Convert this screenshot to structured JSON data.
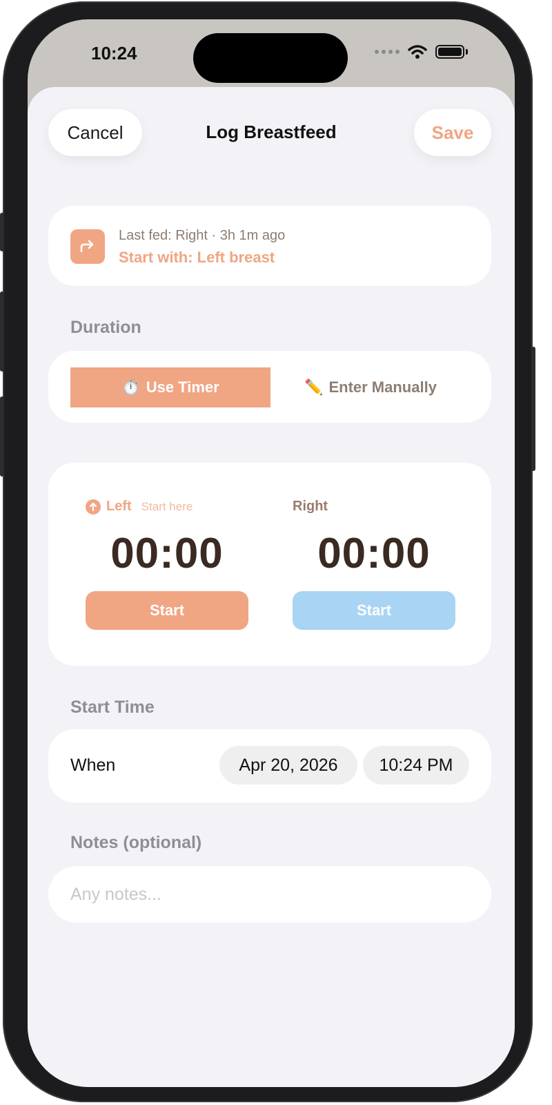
{
  "status_bar": {
    "time": "10:24"
  },
  "header": {
    "cancel_label": "Cancel",
    "title": "Log Breastfeed",
    "save_label": "Save"
  },
  "last_fed": {
    "summary": "Last fed: Right · 3h 1m ago",
    "recommendation": "Start with: Left breast",
    "icon": "arrow-turn-right-icon"
  },
  "duration": {
    "section_label": "Duration",
    "modes": [
      {
        "emoji": "⏱️",
        "label": "Use Timer",
        "selected": true
      },
      {
        "emoji": "✏️",
        "label": "Enter Manually",
        "selected": false
      }
    ]
  },
  "timers": {
    "left": {
      "label": "Left",
      "hint": "Start here",
      "value": "00:00",
      "button_label": "Start"
    },
    "right": {
      "label": "Right",
      "value": "00:00",
      "button_label": "Start"
    }
  },
  "start_time": {
    "section_label": "Start Time",
    "row_label": "When",
    "date": "Apr 20, 2026",
    "time": "10:24 PM"
  },
  "notes": {
    "section_label": "Notes (optional)",
    "placeholder": "Any notes...",
    "value": ""
  },
  "colors": {
    "accent": "#f0a583",
    "right_accent": "#a9d4f3",
    "timer_text": "#3a2a22",
    "sheet_bg": "#f2f2f7"
  }
}
